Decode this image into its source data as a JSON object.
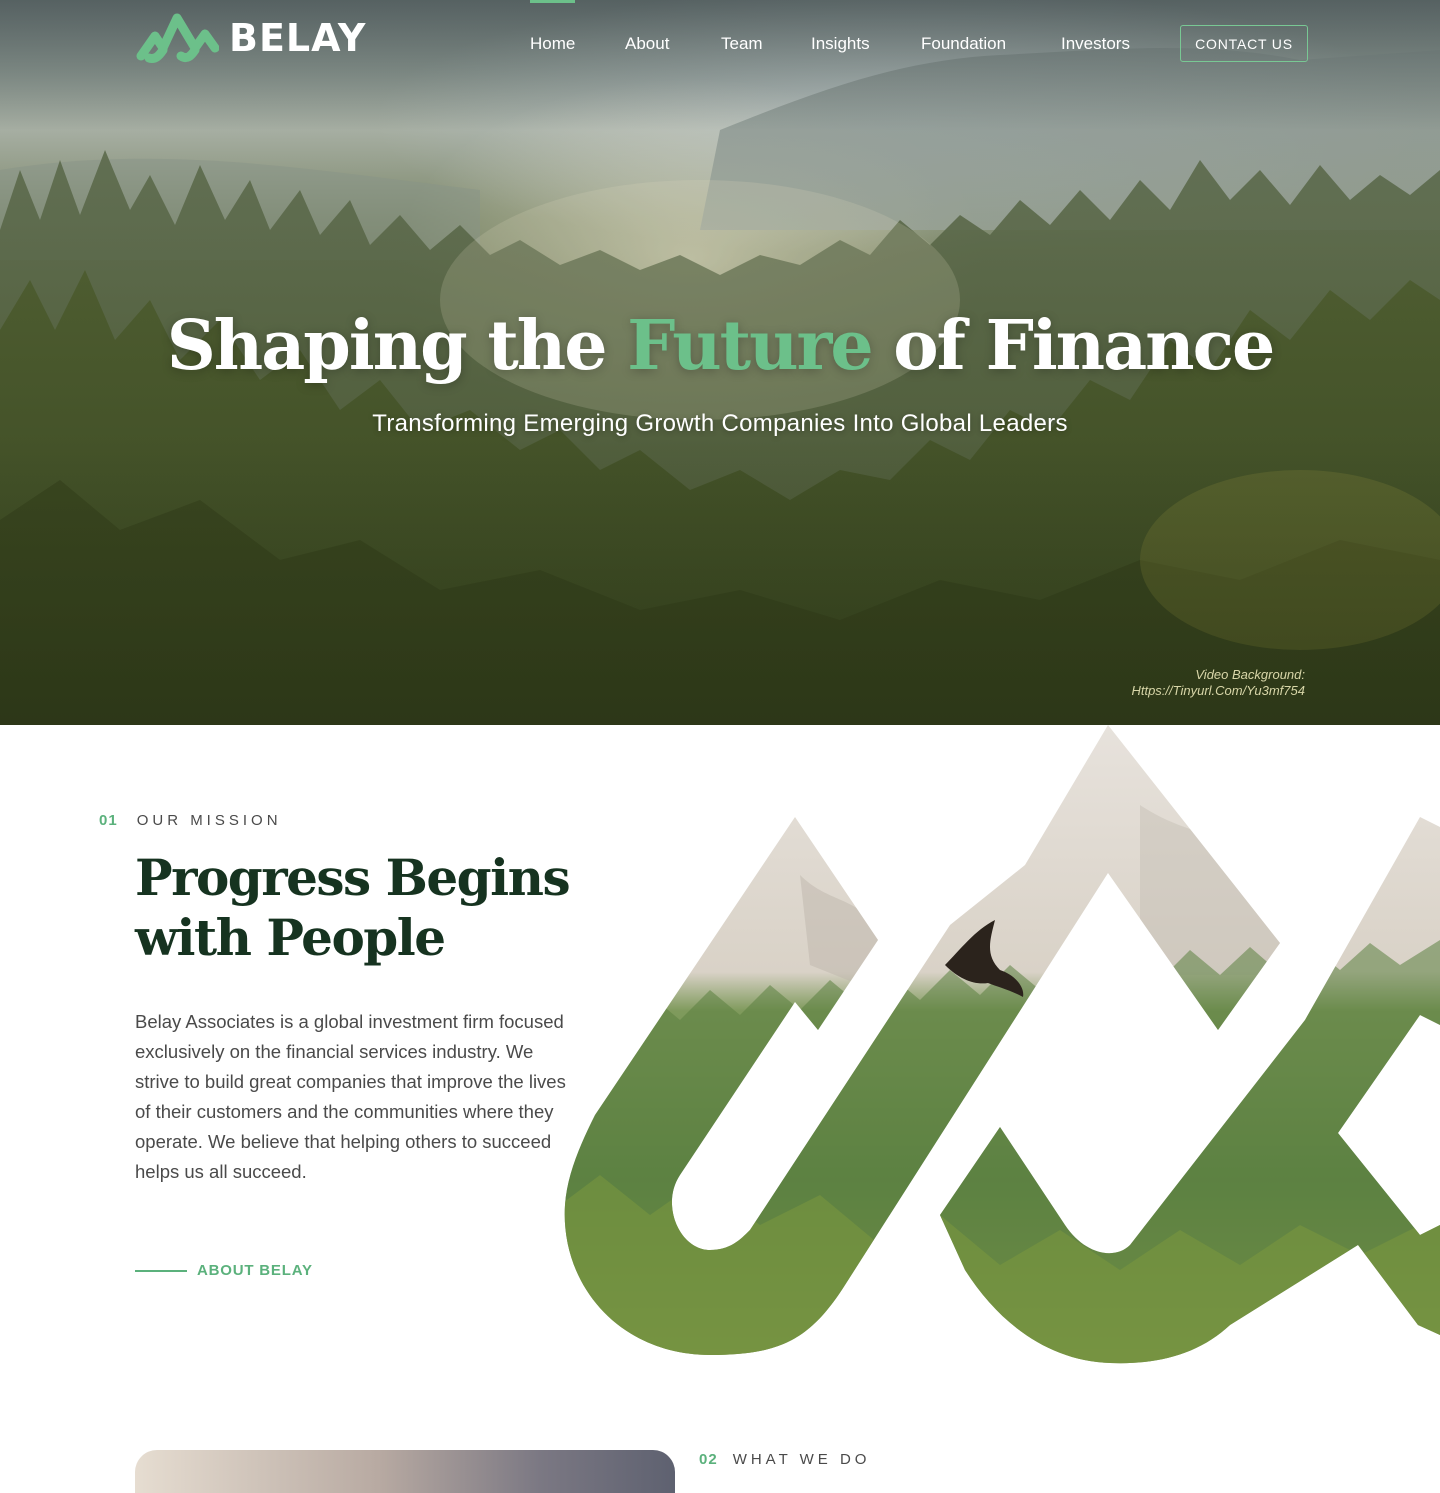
{
  "brand": {
    "name": "BELAY",
    "logo_icon": "mountain-logo-icon",
    "accent_color": "#6cc08a"
  },
  "nav": {
    "items": [
      {
        "label": "Home",
        "active": true
      },
      {
        "label": "About"
      },
      {
        "label": "Team"
      },
      {
        "label": "Insights"
      },
      {
        "label": "Foundation"
      },
      {
        "label": "Investors"
      }
    ],
    "cta": "CONTACT US"
  },
  "hero": {
    "title_before": "Shaping the ",
    "title_accent": "Future",
    "title_after": " of Finance",
    "subtitle": "Transforming Emerging Growth Companies Into Global Leaders",
    "credit_line1": "Video Background:",
    "credit_line2": "Https://Tinyurl.Com/Yu3mf754"
  },
  "mission": {
    "number": "01",
    "label": "OUR MISSION",
    "heading_line1": "Progress Begins",
    "heading_line2": "with People",
    "body": "Belay Associates is a global investment firm focused exclusively on the financial services industry. We strive to build great companies that improve the lives of their customers and the communities where they operate. We believe that helping others to succeed helps us all succeed.",
    "link": "ABOUT BELAY"
  },
  "what_we_do": {
    "number": "02",
    "label": "WHAT WE DO"
  }
}
